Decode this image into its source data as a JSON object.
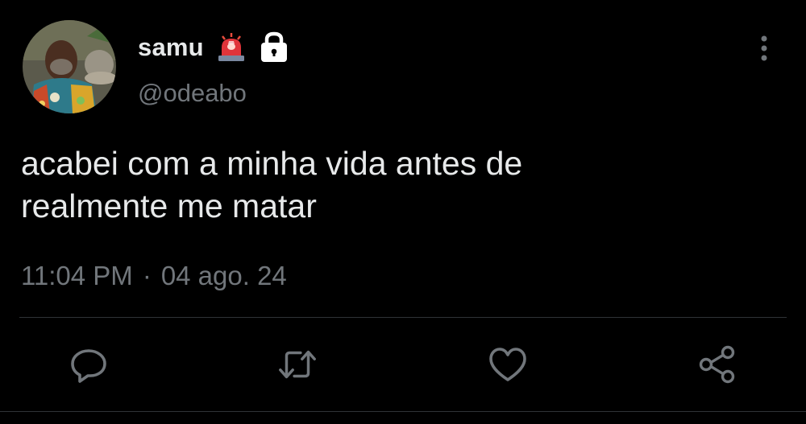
{
  "author": {
    "display_name": "samu",
    "handle": "@odeabo",
    "badges": [
      "police-light-emoji",
      "lock-icon"
    ]
  },
  "tweet": {
    "text": "acabei com a minha vida antes de\nrealmente me matar",
    "time": "11:04 PM",
    "separator": "·",
    "date": "04 ago. 24"
  },
  "actions": {
    "icons": [
      "reply-icon",
      "retweet-icon",
      "like-icon",
      "share-icon"
    ]
  },
  "colors": {
    "background": "#000000",
    "primary_text": "#e7e9ea",
    "secondary_text": "#71767b",
    "divider": "#2f3336"
  }
}
